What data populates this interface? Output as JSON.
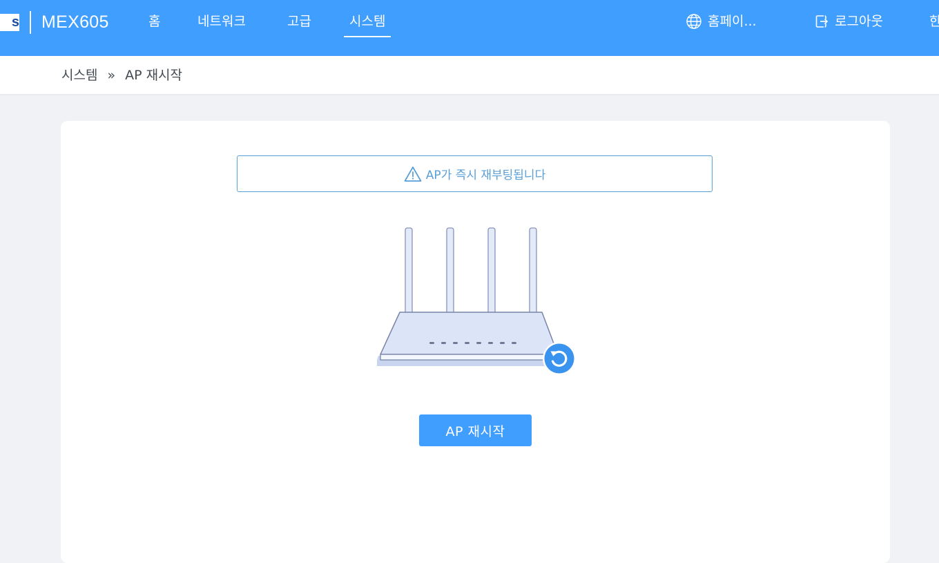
{
  "header": {
    "logo_text": "s",
    "model": "MEX605",
    "nav": [
      {
        "label": "홈",
        "active": false
      },
      {
        "label": "네트워크",
        "active": false
      },
      {
        "label": "고급",
        "active": false
      },
      {
        "label": "시스템",
        "active": true
      }
    ],
    "homepage_label": "홈페이...",
    "logout_label": "로그아웃",
    "language_label": "한",
    "colors": {
      "bar": "#409eff",
      "text": "#ffffff"
    }
  },
  "breadcrumb": {
    "parent": "시스템",
    "separator": "»",
    "current": "AP 재시작"
  },
  "card": {
    "warning_text": "AP가 즉시 재부팅됩니다",
    "warning_color": "#5a9fd6",
    "reboot_button_label": "AP 재시작",
    "button_color": "#409eff"
  }
}
